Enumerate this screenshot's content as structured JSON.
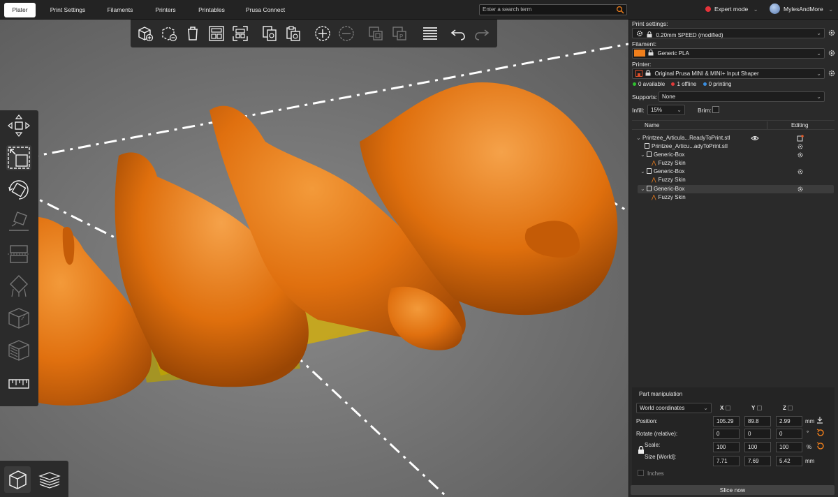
{
  "tabs": [
    "Plater",
    "Print Settings",
    "Filaments",
    "Printers",
    "Printables",
    "Prusa Connect"
  ],
  "search": {
    "placeholder": "Enter a search term"
  },
  "mode": {
    "label": "Expert mode"
  },
  "user": {
    "name": "MylesAndMore"
  },
  "toolbar": {
    "icons": [
      "add-icon",
      "delete-all-icon",
      "delete-icon",
      "arrange-icon",
      "arrange-selection-icon",
      "copy-icon",
      "paste-icon",
      "add-instance-icon",
      "remove-instance-icon",
      "split-objects-icon",
      "split-parts-icon",
      "layers-editing-icon",
      "undo-icon",
      "redo-icon"
    ]
  },
  "left_tools": {
    "icons": [
      "move-icon",
      "scale-icon",
      "rotate-icon",
      "place-on-face-icon",
      "cut-icon",
      "supports-paint-icon",
      "seam-paint-icon",
      "mmu-paint-icon",
      "measure-icon"
    ]
  },
  "view_buttons": {
    "icons": [
      "3d-view-icon",
      "preview-layers-icon"
    ]
  },
  "sidebar": {
    "print_settings_label": "Print settings:",
    "print_settings_value": "0.20mm SPEED (modified)",
    "filament_label": "Filament:",
    "filament_value": "Generic PLA",
    "filament_color": "#f07f1c",
    "printer_label": "Printer:",
    "printer_value": "Original Prusa MINI & MINI+ Input Shaper",
    "status": {
      "available": "0 available",
      "offline": "1 offline",
      "printing": "0 printing"
    },
    "status_colors": {
      "available": "#2fc02f",
      "offline": "#e03a3a",
      "printing": "#3a8ee0"
    },
    "supports_label": "Supports:",
    "supports_value": "None",
    "infill_label": "Infill:",
    "infill_value": "15%",
    "brim_label": "Brim:",
    "list_header": {
      "name": "Name",
      "editing": "Editing"
    },
    "objects": [
      {
        "label": "Printzee_Articula...ReadyToPrint.stl"
      },
      {
        "label": "Printzee_Articu...adyToPrint.stl"
      },
      {
        "label": "Generic-Box"
      },
      {
        "label": "Fuzzy Skin"
      },
      {
        "label": "Generic-Box"
      },
      {
        "label": "Fuzzy Skin"
      },
      {
        "label": "Generic-Box"
      },
      {
        "label": "Fuzzy Skin"
      }
    ]
  },
  "part_manipulation": {
    "title": "Part manipulation",
    "coords": "World coordinates",
    "axes": [
      "X",
      "Y",
      "Z"
    ],
    "position_label": "Position:",
    "position": [
      "105.29",
      "89.8",
      "2.99"
    ],
    "rotate_label": "Rotate (relative):",
    "rotate": [
      "0",
      "0",
      "0"
    ],
    "scale_label": "Scale:",
    "scale": [
      "100",
      "100",
      "100"
    ],
    "size_label": "Size [World]:",
    "size": [
      "7.71",
      "7.69",
      "5.42"
    ],
    "units": {
      "position": "mm",
      "rotate": "°",
      "scale": "%",
      "size": "mm"
    },
    "inches_label": "Inches"
  },
  "slice_button": "Slice now"
}
